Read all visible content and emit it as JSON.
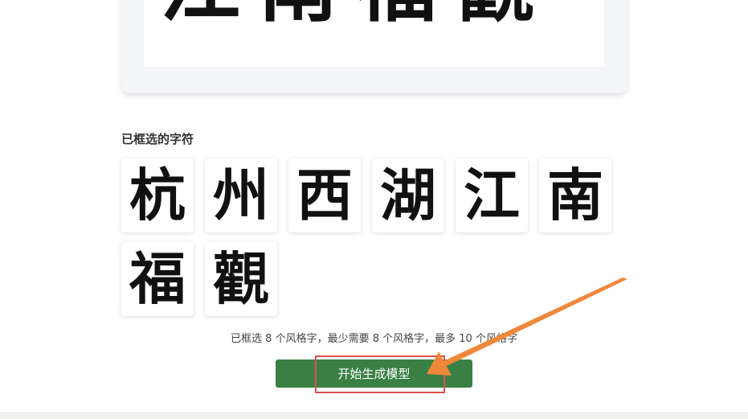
{
  "preview": {
    "text": "江南福觀"
  },
  "selection": {
    "title": "已框选的字符",
    "characters": [
      "杭",
      "州",
      "西",
      "湖",
      "江",
      "南",
      "福",
      "觀"
    ],
    "status": "已框选 8 个风格字，最少需要 8 个风格字，最多 10 个风格字"
  },
  "actions": {
    "start_label": "开始生成模型"
  },
  "colors": {
    "button": "#3a8045",
    "highlight": "#e05050",
    "arrow": "#f0883c"
  }
}
